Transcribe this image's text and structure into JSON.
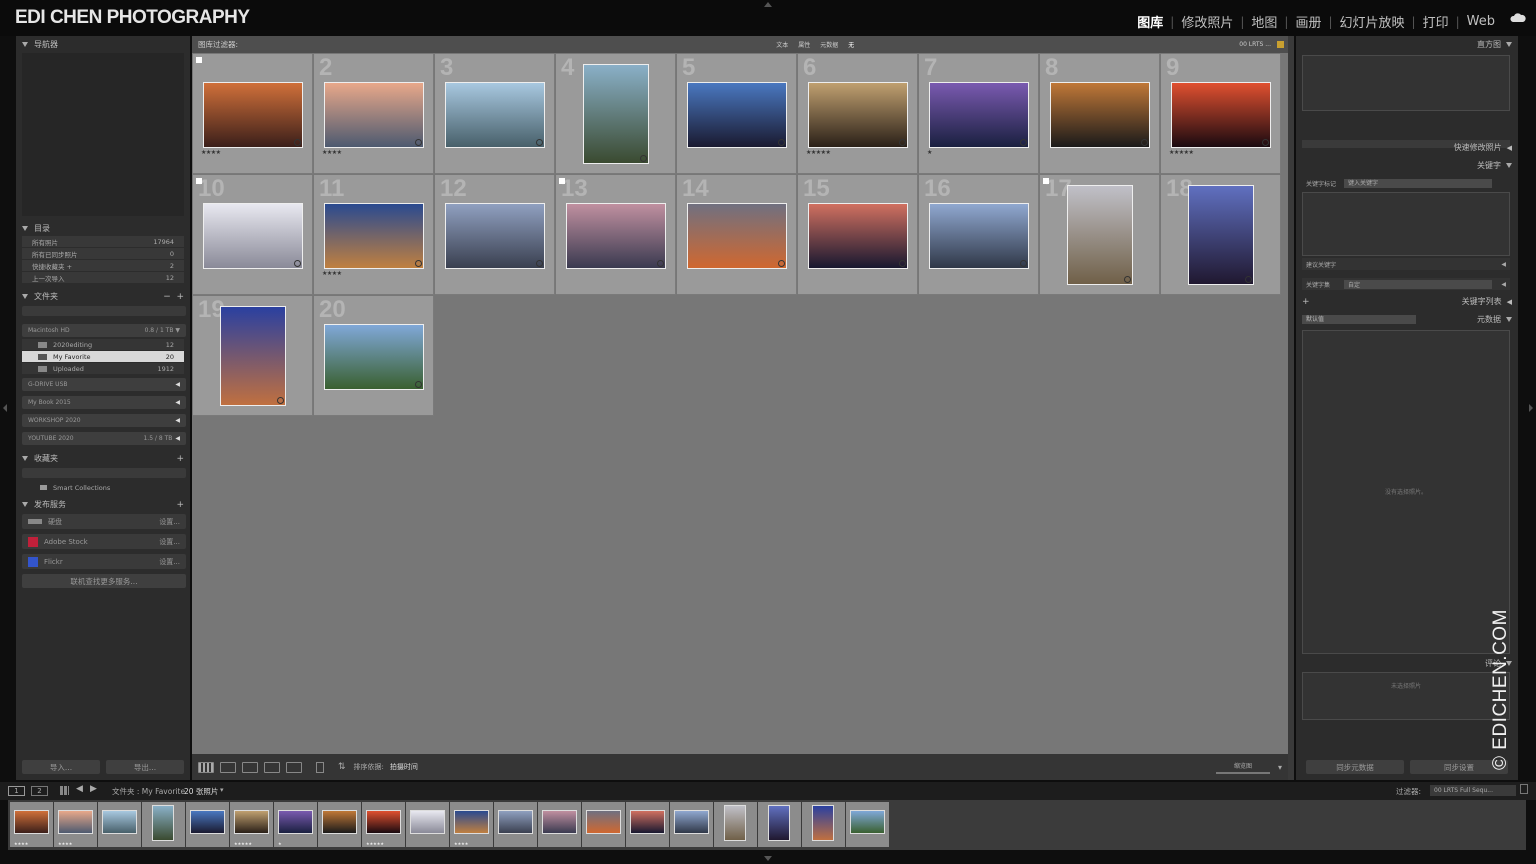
{
  "brand": "EDI CHEN PHOTOGRAPHY",
  "modules": [
    "图库",
    "修改照片",
    "地图",
    "画册",
    "幻灯片放映",
    "打印",
    "Web"
  ],
  "left": {
    "navigator": "导航器",
    "catalog": {
      "title": "目录",
      "items": [
        {
          "label": "所有照片",
          "count": "17964"
        },
        {
          "label": "所有已同步照片",
          "count": "0"
        },
        {
          "label": "快捷收藏夹 +",
          "count": "2"
        },
        {
          "label": "上一次导入",
          "count": "12"
        }
      ]
    },
    "folders": {
      "title": "文件夹",
      "volume": "Macintosh HD",
      "volume_info": "0.8 / 1 TB",
      "items": [
        {
          "label": "2020editing",
          "count": "12"
        },
        {
          "label": "My Favorite",
          "count": "20"
        },
        {
          "label": "Uploaded",
          "count": "1912"
        }
      ],
      "drives": [
        {
          "label": "G-DRIVE USB",
          "info": ""
        },
        {
          "label": "My Book 2015",
          "info": ""
        },
        {
          "label": "WORKSHOP 2020",
          "info": ""
        },
        {
          "label": "YOUTUBE 2020",
          "info": "1.5 / 8 TB"
        }
      ]
    },
    "collections": {
      "title": "收藏夹",
      "smart": "Smart Collections"
    },
    "publish": {
      "title": "发布服务",
      "services": [
        {
          "label": "硬盘",
          "action": "设置..."
        },
        {
          "label": "Adobe Stock",
          "action": "设置..."
        },
        {
          "label": "Flickr",
          "action": "设置..."
        }
      ],
      "more": "联机查找更多服务..."
    },
    "import_label": "导入...",
    "export_label": "导出..."
  },
  "filterbar": {
    "title": "图库过滤器:",
    "tabs": [
      "文本",
      "属性",
      "元数据",
      "无"
    ],
    "preset": "00 LRTS ..."
  },
  "grid": [
    {
      "n": "",
      "stars": "★★★★",
      "flag": true,
      "c": [
        "#d0703a",
        "#3b1f1a"
      ],
      "w": 100,
      "h": 66
    },
    {
      "n": "2",
      "stars": "★★★★",
      "flag": false,
      "c": [
        "#e8a88a",
        "#4d5a70"
      ],
      "w": 100,
      "h": 66
    },
    {
      "n": "3",
      "stars": "",
      "flag": false,
      "c": [
        "#a8c8e0",
        "#48606a"
      ],
      "w": 100,
      "h": 66
    },
    {
      "n": "4",
      "stars": "",
      "flag": false,
      "c": [
        "#8ab0c8",
        "#3a4a30"
      ],
      "w": 66,
      "h": 100
    },
    {
      "n": "5",
      "stars": "",
      "flag": false,
      "c": [
        "#4a78c0",
        "#1a1a30"
      ],
      "w": 100,
      "h": 66
    },
    {
      "n": "6",
      "stars": "★★★★★",
      "flag": false,
      "c": [
        "#c0a070",
        "#2a2018"
      ],
      "w": 100,
      "h": 66
    },
    {
      "n": "7",
      "stars": "★",
      "flag": false,
      "c": [
        "#7a5ab0",
        "#1a2040"
      ],
      "w": 100,
      "h": 66
    },
    {
      "n": "8",
      "stars": "",
      "flag": false,
      "c": [
        "#c07838",
        "#1a1a1a"
      ],
      "w": 100,
      "h": 66
    },
    {
      "n": "9",
      "stars": "★★★★★",
      "flag": false,
      "c": [
        "#e05030",
        "#1a0a10"
      ],
      "w": 100,
      "h": 66
    },
    {
      "n": "10",
      "stars": "",
      "flag": true,
      "c": [
        "#e8e8f0",
        "#8a8a98"
      ],
      "w": 100,
      "h": 66
    },
    {
      "n": "11",
      "stars": "★★★★",
      "flag": false,
      "c": [
        "#2a4a90",
        "#c08040"
      ],
      "w": 100,
      "h": 66
    },
    {
      "n": "12",
      "stars": "",
      "flag": false,
      "c": [
        "#90a0c0",
        "#3a4050"
      ],
      "w": 100,
      "h": 66
    },
    {
      "n": "13",
      "stars": "",
      "flag": true,
      "c": [
        "#c090a0",
        "#3a3a50"
      ],
      "w": 100,
      "h": 66
    },
    {
      "n": "14",
      "stars": "",
      "flag": false,
      "c": [
        "#707080",
        "#d06830"
      ],
      "w": 100,
      "h": 66
    },
    {
      "n": "15",
      "stars": "",
      "flag": false,
      "c": [
        "#d07060",
        "#181830"
      ],
      "w": 100,
      "h": 66
    },
    {
      "n": "16",
      "stars": "",
      "flag": false,
      "c": [
        "#90a8d0",
        "#303848"
      ],
      "w": 100,
      "h": 66
    },
    {
      "n": "17",
      "stars": "",
      "flag": true,
      "c": [
        "#c0c0c8",
        "#706048"
      ],
      "w": 66,
      "h": 100
    },
    {
      "n": "18",
      "stars": "",
      "flag": false,
      "c": [
        "#6070c0",
        "#201830"
      ],
      "w": 66,
      "h": 100
    },
    {
      "n": "19",
      "stars": "",
      "flag": false,
      "c": [
        "#2a40a0",
        "#c07040"
      ],
      "w": 66,
      "h": 100
    },
    {
      "n": "20",
      "stars": "",
      "flag": false,
      "c": [
        "#80a8d8",
        "#3a6030"
      ],
      "w": 100,
      "h": 66
    }
  ],
  "toolbar": {
    "sort_label": "排序依据:",
    "sort_value": "拍摄时间",
    "thumb_label": "缩览图"
  },
  "right": {
    "histogram": "直方图",
    "quick_develop": "快速修改照片",
    "keywords": "关键字",
    "keyword_tags": "关键字标记",
    "keyword_input": "键入关键字",
    "suggested": "建议关键字",
    "keyword_set": "关键字集",
    "keyword_set_value": "自定",
    "keyword_list": "关键字列表",
    "metadata": "元数据",
    "metadata_preset": "默认值",
    "no_photo": "没有选择照片。",
    "comments": "评论",
    "no_photo2": "未选择照片",
    "sync_meta": "同步元数据",
    "sync_settings": "同步设置"
  },
  "filmbar": {
    "page1": "1",
    "page2": "2",
    "path": "文件夹 : My Favorite",
    "count": "20 张照片",
    "filter_label": "过滤器:",
    "filter_value": "00 LRTS Full Sequ..."
  },
  "watermark": "© EDICHEN.COM"
}
